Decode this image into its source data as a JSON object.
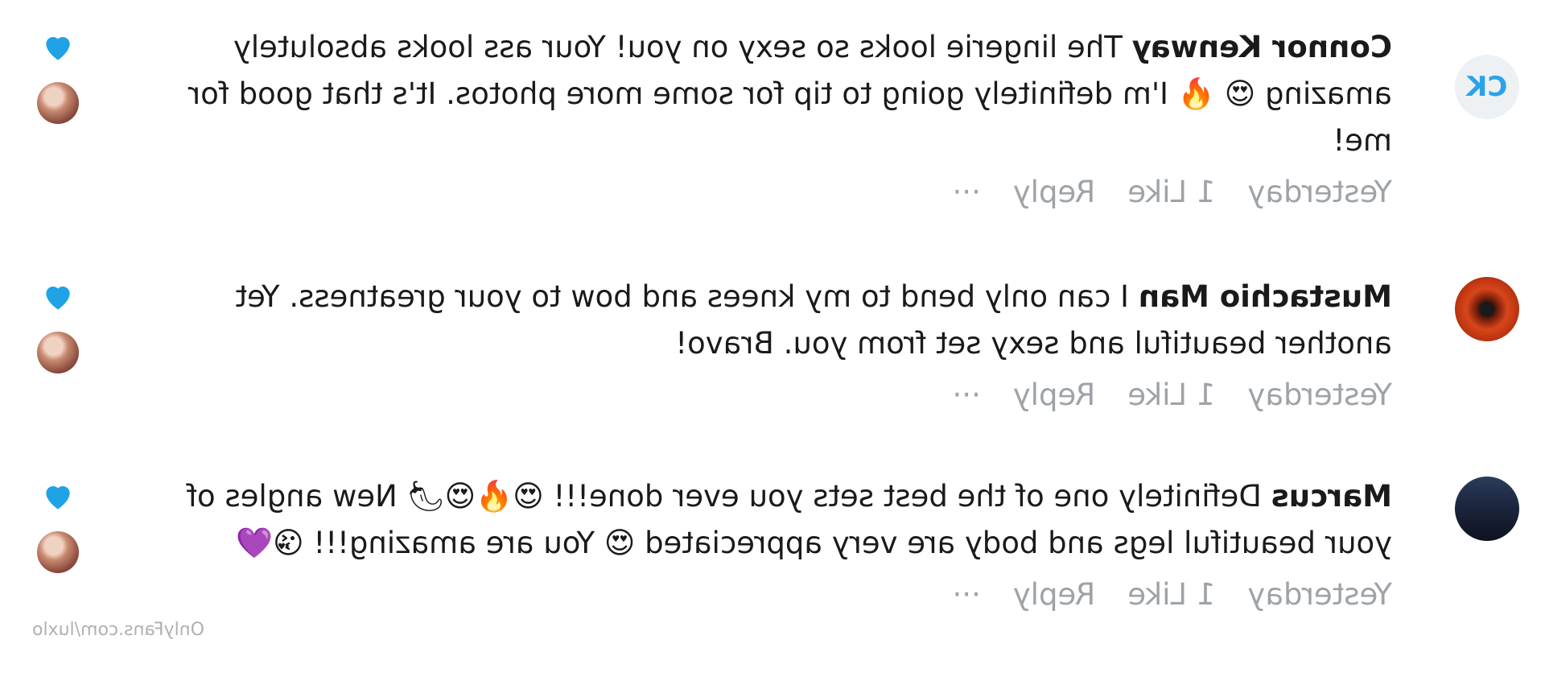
{
  "comments": [
    {
      "author": "Connor Kenway",
      "initials": "CK",
      "text": "The lingerie looks so sexy on you! Your ass looks absolutely amazing 😍 🔥 I'm definitely going to tip for some more photos. It's that good for me!",
      "time": "Yesterday",
      "likes": "1 Like",
      "reply": "Reply",
      "more": "···"
    },
    {
      "author": "Mustachio Man",
      "text": "I can only bend to my knees and bow to your greatness. Yet another beautiful and sexy set from you. Bravo!",
      "time": "Yesterday",
      "likes": "1 Like",
      "reply": "Reply",
      "more": "···"
    },
    {
      "author": "Marcus",
      "text": "Definitely one of the best sets you ever done!!! 😍🔥😍🌶 New angles of your beautiful legs and body are very appreciated 😍 You are amazing!!! 😘💜",
      "time": "Yesterday",
      "likes": "1 Like",
      "reply": "Reply",
      "more": "···"
    }
  ],
  "watermark": "OnlyFans.com/luxlo",
  "colors": {
    "heart": "#1fa2e6",
    "meta": "#9ea3a8",
    "initials": "#2aa3e8"
  },
  "icons": [
    "heart-icon",
    "creator-avatar"
  ]
}
